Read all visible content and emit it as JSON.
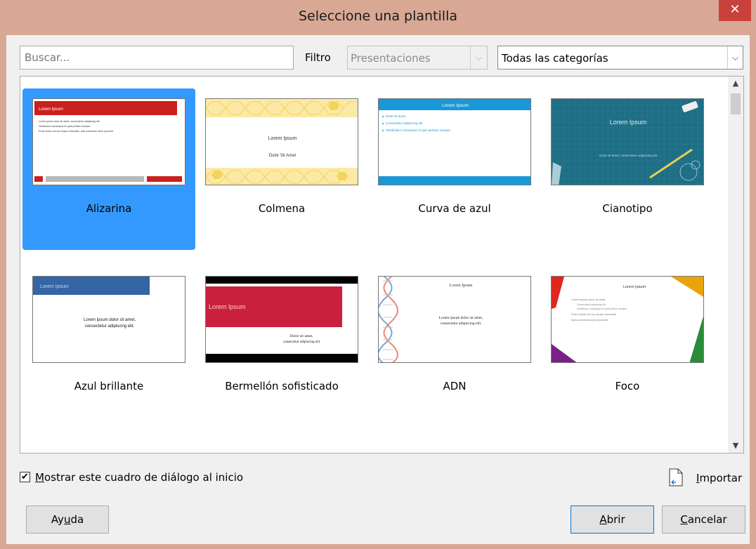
{
  "window": {
    "title": "Seleccione una plantilla",
    "close_glyph": "✕"
  },
  "search": {
    "placeholder": "Buscar..."
  },
  "filter": {
    "label": "Filtro",
    "type_value": "Presentaciones",
    "category_value": "Todas las categorías"
  },
  "templates": [
    {
      "name": "Alizarina",
      "selected": true
    },
    {
      "name": "Colmena",
      "selected": false
    },
    {
      "name": "Curva de azul",
      "selected": false
    },
    {
      "name": "Cianotipo",
      "selected": false
    },
    {
      "name": "Azul brillante",
      "selected": false
    },
    {
      "name": "Bermellón sofisticado",
      "selected": false
    },
    {
      "name": "ADN",
      "selected": false
    },
    {
      "name": "Foco",
      "selected": false
    }
  ],
  "thumb_text": {
    "lorem_ipsum": "Lorem Ipsum",
    "dolor_sit_amet": "Dolor Sit Amet",
    "dolor_sit_amet_comma": "Dolor sit amet,",
    "consectetur_elit": "consectetur adipiscing elit",
    "lorem_line1": "Lorem ipsum dolor sit amet,",
    "lorem_line2": "consectetur adipiscing elit.",
    "azul_lines": [
      "Dolor sit amet",
      "Consectetur adipiscing elit",
      "Vestibulum consequat mi quis pretium semper"
    ],
    "ciano_sub": "Dolor sit amet, consectetur adipiscing elit",
    "foco_lines": [
      "Lorem ipsum dolor sit amet",
      "Consectetur adipiscing elit",
      "Vestibulum consequat mi quis pretium semper",
      "Proin luctus orci ac neque venenatis",
      "Quis commodo dolor posuere."
    ],
    "aliz_lines": [
      "Lorem ipsum dolor sit amet, consectetur adipiscing elit.",
      "Vestibulum consequat mi quis pretium semper.",
      "Proin luctus orci ac neque venenatis, quis commodo dolor posuere."
    ]
  },
  "show_on_start": {
    "label_prefix": "",
    "label_accel": "M",
    "label_rest": "ostrar este cuadro de diálogo al inicio",
    "checked": true
  },
  "import": {
    "label_accel": "I",
    "label_rest": "mportar"
  },
  "buttons": {
    "help": {
      "pre": "Ay",
      "accel": "u",
      "post": "da"
    },
    "open": {
      "pre": "",
      "accel": "A",
      "post": "brir"
    },
    "cancel": {
      "pre": "",
      "accel": "C",
      "post": "ancelar"
    }
  },
  "colors": {
    "selection": "#3399ff",
    "titlebar": "#d8a895",
    "close": "#c8413a"
  }
}
